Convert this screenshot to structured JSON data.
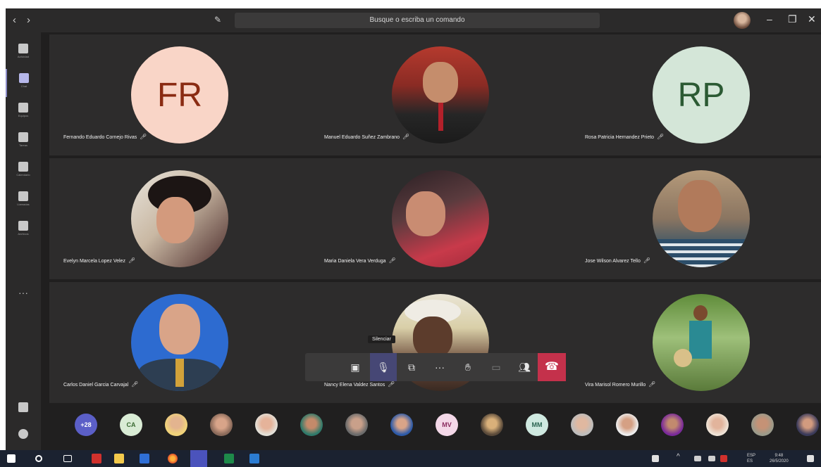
{
  "titlebar": {
    "back": "‹",
    "forward": "›",
    "search_placeholder": "Busque o escriba un comando",
    "minimize": "–",
    "restore": "❐",
    "close": "✕"
  },
  "rail": {
    "items": [
      {
        "label": "Actividad",
        "icon": "bell-icon"
      },
      {
        "label": "Chat",
        "icon": "chat-icon"
      },
      {
        "label": "Equipos",
        "icon": "teams-icon"
      },
      {
        "label": "Tareas",
        "icon": "tasks-icon"
      },
      {
        "label": "Calendario",
        "icon": "calendar-icon"
      },
      {
        "label": "Llamadas",
        "icon": "phone-icon"
      },
      {
        "label": "Archivos",
        "icon": "files-icon"
      }
    ],
    "more": "···"
  },
  "grid": {
    "tiles": [
      {
        "name": "Fernando Eduardo Cornejo Rivas",
        "initials": "FR",
        "kind": "initials",
        "bg": "#f9d5c7",
        "fg": "#8a2b12"
      },
      {
        "name": "Manuel Eduardo Suñez Zambrano",
        "kind": "photo"
      },
      {
        "name": "Rosa Patricia Hernandez Prieto",
        "initials": "RP",
        "kind": "initials",
        "bg": "#d4e6d8",
        "fg": "#2b5a33"
      },
      {
        "name": "Evelyn Marcela Lopez Velez",
        "kind": "photo"
      },
      {
        "name": "Maria Daniela Vera Verduga",
        "kind": "photo"
      },
      {
        "name": "Jose Wilson Alvarez Tello",
        "kind": "photo"
      },
      {
        "name": "Carlos Daniel Garcia Carvajal",
        "kind": "photo"
      },
      {
        "name": "Nancy Elena Valdez Santos",
        "kind": "photo"
      },
      {
        "name": "Vira Marisol Romero Murillo",
        "kind": "photo"
      }
    ]
  },
  "controls": {
    "tooltip": "Silenciar",
    "timer": "",
    "more": "···",
    "hangup": "☎"
  },
  "strip": {
    "overflow_count": "+28",
    "items": [
      {
        "label": "CA",
        "kind": "initials",
        "bg": "#d9ecd5",
        "fg": "#3b6b33"
      },
      {
        "label": "",
        "kind": "photo"
      },
      {
        "label": "",
        "kind": "photo"
      },
      {
        "label": "",
        "kind": "photo"
      },
      {
        "label": "",
        "kind": "photo"
      },
      {
        "label": "",
        "kind": "photo"
      },
      {
        "label": "",
        "kind": "photo"
      },
      {
        "label": "MV",
        "kind": "initials",
        "bg": "#f4d8e8",
        "fg": "#8a2a5e"
      },
      {
        "label": "",
        "kind": "photo"
      },
      {
        "label": "MM",
        "kind": "initials",
        "bg": "#cfe9e0",
        "fg": "#2b6451"
      },
      {
        "label": "",
        "kind": "photo"
      },
      {
        "label": "",
        "kind": "photo"
      },
      {
        "label": "",
        "kind": "photo"
      },
      {
        "label": "",
        "kind": "photo"
      },
      {
        "label": "",
        "kind": "photo"
      },
      {
        "label": "",
        "kind": "photo"
      }
    ]
  },
  "taskbar": {
    "lang_line1": "ESP",
    "lang_line2": "ES",
    "time": "9:48",
    "date": "26/5/2020"
  }
}
